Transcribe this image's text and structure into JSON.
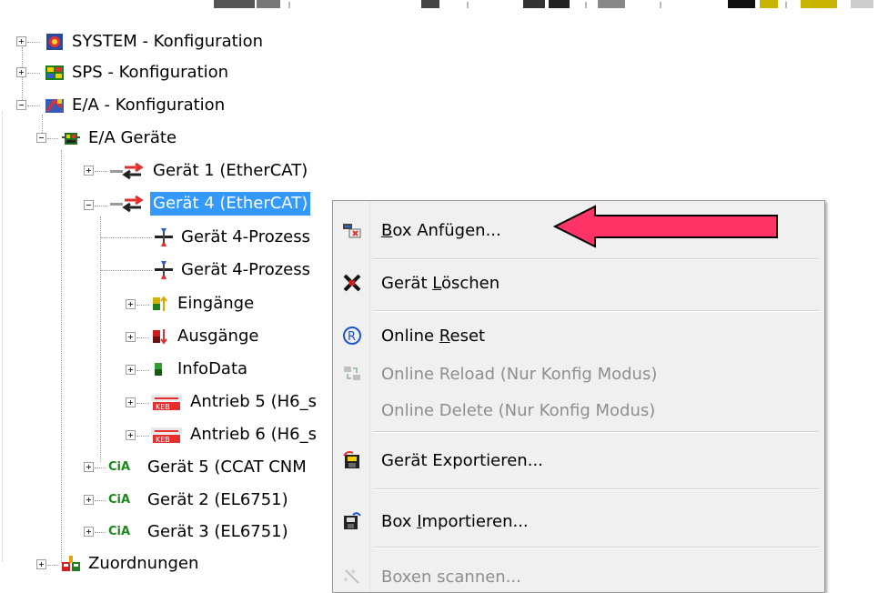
{
  "tree": {
    "system": "SYSTEM - Konfiguration",
    "sps": "SPS - Konfiguration",
    "ea": "E/A - Konfiguration",
    "ea_geraete": "E/A Geräte",
    "geraet1": "Gerät 1 (EtherCAT)",
    "geraet4": "Gerät 4 (EtherCAT)",
    "prozess1": "Gerät 4-Prozess",
    "prozess2": "Gerät 4-Prozess",
    "eingaenge": "Eingänge",
    "ausgaenge": "Ausgänge",
    "infodata": "InfoData",
    "antrieb5": "Antrieb 5 (H6_s",
    "antrieb6": "Antrieb 6 (H6_s",
    "geraet5": "Gerät 5 (CCAT CNM",
    "geraet2": "Gerät 2 (EL6751)",
    "geraet3": "Gerät 3 (EL6751)",
    "zuordnungen": "Zuordnungen",
    "cia_label": "CiA"
  },
  "context_menu": {
    "items": [
      {
        "label": "Box Anfügen...",
        "mnemonic": "B",
        "rest": "ox Anfügen...",
        "enabled": true,
        "icon": "add-box-icon"
      },
      {
        "label": "Gerät Löschen",
        "pre": "Gerät ",
        "mnemonic": "L",
        "rest": "öschen",
        "enabled": true,
        "icon": "delete-icon"
      },
      {
        "label": "Online Reset",
        "pre": "Online ",
        "mnemonic": "R",
        "rest": "eset",
        "enabled": true,
        "icon": "reset-icon"
      },
      {
        "label": "Online Reload (Nur Konfig Modus)",
        "enabled": false,
        "icon": "reload-icon"
      },
      {
        "label": "Online Delete (Nur Konfig Modus)",
        "enabled": false,
        "icon": ""
      },
      {
        "label": "Gerät Exportieren...",
        "enabled": true,
        "icon": "export-icon"
      },
      {
        "label": "Box Importieren...",
        "pre": "Box ",
        "mnemonic": "I",
        "rest": "mportieren...",
        "enabled": true,
        "icon": "import-icon"
      },
      {
        "label": "Boxen scannen...",
        "enabled": false,
        "icon": "scan-icon"
      }
    ]
  },
  "colors": {
    "selection": "#3399ff",
    "arrow_fill": "#ff3366",
    "menu_bg": "#f0f0f0"
  }
}
